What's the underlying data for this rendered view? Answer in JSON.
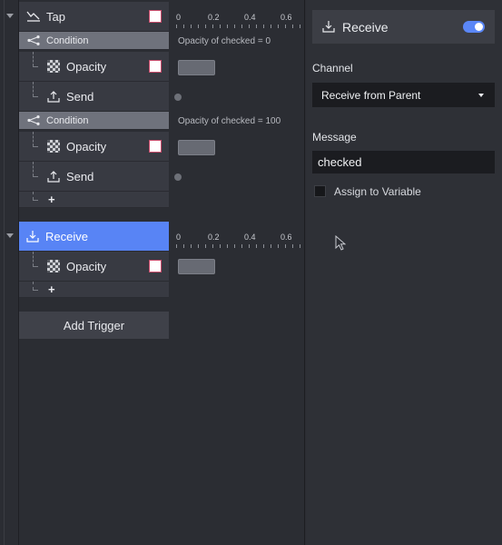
{
  "tree": {
    "tap_trigger": {
      "label": "Tap",
      "icon": "tap-gesture-icon"
    },
    "condition_1": {
      "label": "Condition",
      "icon": "branch-icon",
      "summary": "Opacity of checked = 0"
    },
    "opacity_1": {
      "label": "Opacity",
      "icon": "checker-icon"
    },
    "send_1": {
      "label": "Send",
      "icon": "upload-icon"
    },
    "condition_2": {
      "label": "Condition",
      "icon": "branch-icon",
      "summary": "Opacity of checked = 100"
    },
    "opacity_2": {
      "label": "Opacity",
      "icon": "checker-icon"
    },
    "send_2": {
      "label": "Send",
      "icon": "upload-icon"
    },
    "add_plus_1": "+",
    "receive_trigger": {
      "label": "Receive",
      "icon": "download-icon"
    },
    "opacity_3": {
      "label": "Opacity",
      "icon": "checker-icon"
    },
    "add_plus_2": "+",
    "add_trigger": "Add Trigger"
  },
  "ruler": {
    "ticks": [
      "0",
      "0.2",
      "0.4",
      "0.6"
    ]
  },
  "panel": {
    "title": "Receive",
    "enabled": true,
    "channel_label": "Channel",
    "channel_value": "Receive from Parent",
    "message_label": "Message",
    "message_value": "checked",
    "assign_label": "Assign to Variable",
    "assign_checked": false
  },
  "colors": {
    "accent": "#5884f5",
    "condition_bg": "#6f727c"
  }
}
